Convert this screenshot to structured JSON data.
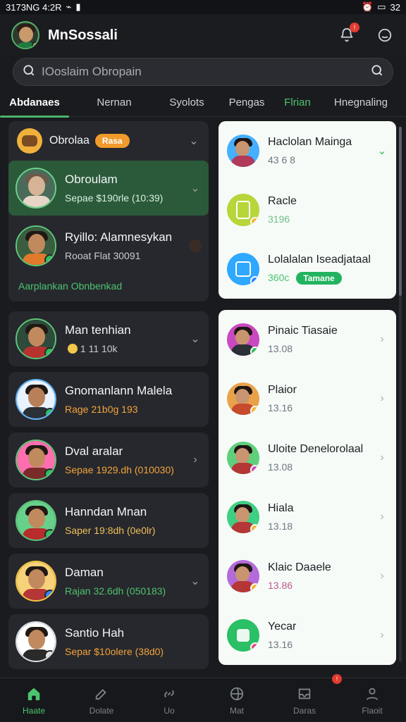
{
  "status": {
    "left": "3173NG 4:2R",
    "right": "32"
  },
  "topbar": {
    "title": "MnSossali"
  },
  "search": {
    "placeholder": "IOoslaim Obropain"
  },
  "tabs": [
    {
      "label": "Abdanaes"
    },
    {
      "label": "Nernan"
    },
    {
      "label": "Syolots"
    },
    {
      "label": "Pengas"
    },
    {
      "label": "Flrian"
    },
    {
      "label": "Hnegnaling"
    }
  ],
  "left": {
    "group": {
      "label": "Obrolaa",
      "pill": "Rasa"
    },
    "items": [
      {
        "name": "Obroulam",
        "sub": "Sepae $190rle (10:39)"
      },
      {
        "name": "Ryillo: Alamnesykan",
        "sub": "Rooat Flat 30091",
        "footer": "Aarplankan Obnbenkad"
      },
      {
        "name": "Man tenhian",
        "sub": "1 11 10k"
      },
      {
        "name": "Gnomanlann Malela",
        "sub": "Rage 21b0g 193"
      },
      {
        "name": "Dval aralar",
        "sub": "Sepae 1929.dh (010030)"
      },
      {
        "name": "Hanndan Mnan",
        "sub": "Saper 19:8dh (0e0lr)"
      },
      {
        "name": "Daman",
        "sub": "Rajan 32.6dh (050183)"
      },
      {
        "name": "Santio Hah",
        "sub": "Separ $10olere (38d0)"
      }
    ]
  },
  "right": {
    "top": [
      {
        "name": "Haclolan Mainga",
        "sub": "43 6 8"
      },
      {
        "name": "Racle",
        "sub": "3196"
      },
      {
        "name": "Lolalalan Iseadjataal",
        "sub": "360c",
        "pill": "Tamane"
      }
    ],
    "bottom": [
      {
        "name": "Pinaic Tiasaie",
        "sub": "13.08"
      },
      {
        "name": "Plaior",
        "sub": "13.16"
      },
      {
        "name": "Uloite Denelorolaal",
        "sub": "13.08"
      },
      {
        "name": "Hiala",
        "sub": "13.18"
      },
      {
        "name": "Klaic Daaele",
        "sub": "13.86"
      },
      {
        "name": "Yecar",
        "sub": "13.16"
      }
    ]
  },
  "nav": [
    {
      "label": "Haate"
    },
    {
      "label": "Dolate"
    },
    {
      "label": "Uo"
    },
    {
      "label": "Mat"
    },
    {
      "label": "Daras"
    },
    {
      "label": "Flaoit"
    }
  ],
  "icons": {
    "bell": "bell-icon",
    "profile": "profile-icon",
    "search": "search-icon",
    "chevron": "chevron-icon",
    "home": "home-icon"
  }
}
